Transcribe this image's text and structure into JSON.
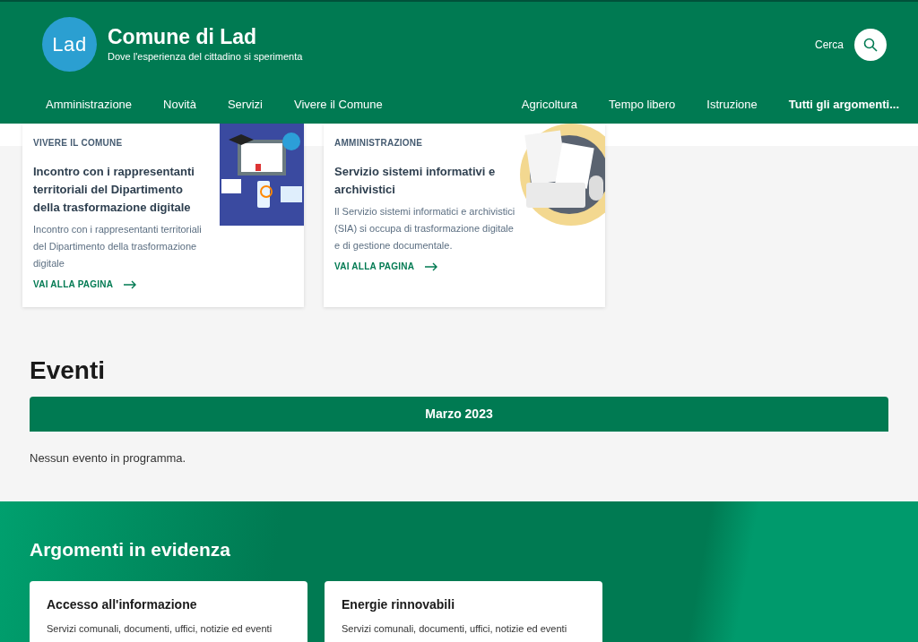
{
  "header": {
    "logo_text": "Lad",
    "title": "Comune di Lad",
    "tagline": "Dove l'esperienza del cittadino si sperimenta",
    "search_label": "Cerca"
  },
  "nav_left": [
    "Amministrazione",
    "Novità",
    "Servizi",
    "Vivere il Comune"
  ],
  "nav_right": [
    {
      "label": "Agricoltura",
      "kind": "link"
    },
    {
      "label": "Tempo libero",
      "kind": "link"
    },
    {
      "label": "Istruzione",
      "kind": "link"
    },
    {
      "label": "Tutti gli argomenti...",
      "kind": "all"
    }
  ],
  "cards": [
    {
      "category": "VIVERE IL COMUNE",
      "title": "Incontro con i rappresentanti territoriali del Dipartimento della trasformazione digitale",
      "text": "Incontro con i rappresentanti territoriali del Dipartimento della trasformazione digitale",
      "link": "VAI ALLA PAGINA"
    },
    {
      "category": "AMMINISTRAZIONE",
      "title": "Servizio sistemi informativi e archivistici",
      "text": "Il Servizio sistemi informatici e archivistici (SIA) si occupa di trasformazione digitale e di gestione documentale.",
      "link": "VAI ALLA PAGINA"
    }
  ],
  "events": {
    "heading": "Eventi",
    "month": "Marzo 2023",
    "empty": "Nessun evento in programma."
  },
  "topics": {
    "heading": "Argomenti in evidenza",
    "cards": [
      {
        "title": "Accesso all'informazione",
        "text": "Servizi comunali, documenti, uffici, notizie ed eventi"
      },
      {
        "title": "Energie rinnovabili",
        "text": "Servizi comunali, documenti, uffici, notizie ed eventi"
      }
    ]
  }
}
